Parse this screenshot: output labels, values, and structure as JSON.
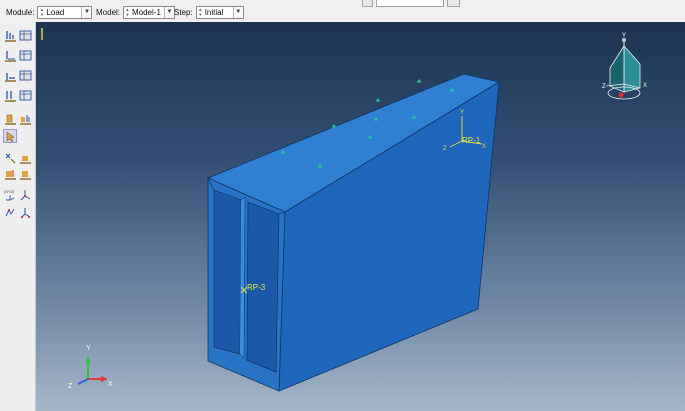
{
  "context_bar": {
    "module_label": "Module:",
    "module_value": "Load",
    "model_label": "Model:",
    "model_value": "Model-1",
    "step_label": "Step:",
    "step_value": "Initial"
  },
  "toolbox": {
    "tools": [
      "create-load-icon",
      "load-manager-icon",
      "create-bc-icon",
      "bc-manager-icon",
      "create-predefined-field-icon",
      "predefined-field-manager-icon",
      "create-load-case-icon",
      "load-case-manager-icon",
      "create-load-pressure-icon",
      "load-pressure-manager-icon",
      "query-tool-icon",
      "create-constraint-icon",
      "constraint-manager-icon",
      "create-connector-icon",
      "connector-manager-icon",
      "datum-csys-icon",
      "datum-axis-icon",
      "datum-point-icon",
      "datum-plane-icon"
    ]
  },
  "viewport": {
    "reference_points": [
      {
        "label": "RP-1"
      },
      {
        "label": "RP-3"
      }
    ],
    "triad": {
      "x": "X",
      "y": "Y",
      "z": "Z"
    },
    "view_cube": {
      "x": "X",
      "y": "Y",
      "z": "Z"
    },
    "colors": {
      "part_face_top": "#2f7fd3",
      "part_face_side": "#1f66bd",
      "part_face_end": "#2a74c8",
      "load_marker": "#23c79a",
      "rp_label": "#e8e238"
    }
  }
}
